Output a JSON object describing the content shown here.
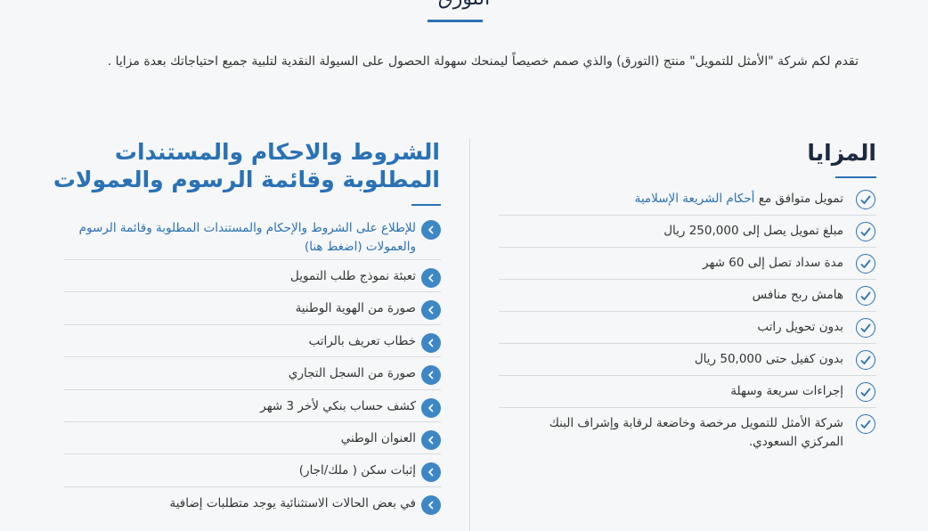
{
  "page": {
    "title": "التورق",
    "intro": "تقدم لكم شركة \"الأمثل للتمويل\" منتج (التورق) والذي صمم خصيصاً ليمنحك سهولة الحصول على السيولة النقدية لتلبية جميع احتياجاتك بعدة مزايا ."
  },
  "features": {
    "heading": "المزايا",
    "items": [
      {
        "prefix": "تمويل متوافق مع ",
        "link": "أحكام الشريعة الإسلامية"
      },
      {
        "text": "مبلغ تمويل يصل إلى 250,000 ريال"
      },
      {
        "text": "مدة سداد تصل إلى 60 شهر"
      },
      {
        "text": "هامش ربح منافس"
      },
      {
        "text": "بدون تحويل راتب"
      },
      {
        "text": "بدون كفيل حتى 50,000 ريال"
      },
      {
        "text": "إجراءات سريعة وسهلة"
      },
      {
        "text": "شركة الأمثل للتمويل مرخصة وخاضعة لرقابة وإشراف البنك المركزي السعودي."
      }
    ]
  },
  "terms": {
    "heading": "الشروط والاحكام والمستندات المطلوبة وقائمة الرسوم والعمولات",
    "link_text": "للإطلاع على الشروط والإحكام والمستندات المطلوبة وقائمة الرسوم والعمولات (اضغط هنا)",
    "items": [
      "تعبئة نموذج طلب التمويل",
      "صورة من الهوية الوطنية",
      "خطاب تعريف بالراتب",
      "صورة من السجل التجاري",
      "كشف حساب بنكي لأخر 3 شهر",
      "العنوان الوطني",
      "إثبات سكن ( ملك/اجار)",
      "في بعض الحالات الاستثنائية يوجد متطلبات إضافية"
    ]
  },
  "colors": {
    "accent": "#2a72b5",
    "arrow_bg": "#3d87c6",
    "divider": "#d8dbde"
  },
  "icons": {
    "feature_bullet": "check-circle-icon",
    "term_bullet": "chevron-left-circle-icon"
  }
}
